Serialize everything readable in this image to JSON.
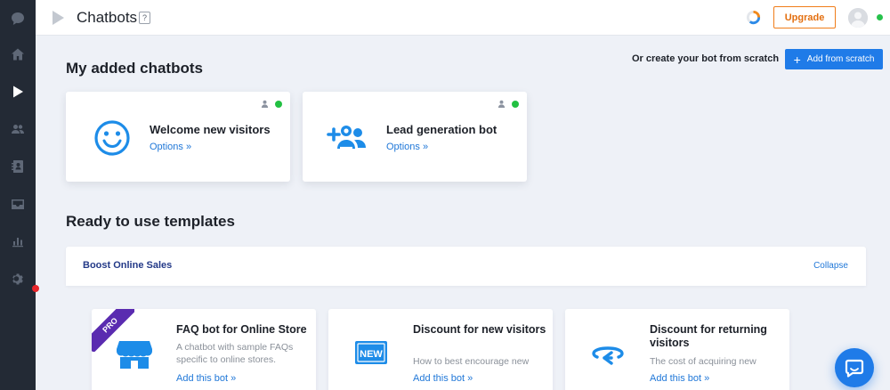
{
  "header": {
    "title": "Chatbots",
    "help_label": "?",
    "upgrade_label": "Upgrade"
  },
  "sidebar": {
    "items": [
      {
        "icon": "chat-icon"
      },
      {
        "icon": "home-icon"
      },
      {
        "icon": "play-icon",
        "active": true
      },
      {
        "icon": "users-icon"
      },
      {
        "icon": "contacts-icon"
      },
      {
        "icon": "inbox-icon"
      },
      {
        "icon": "stats-icon"
      },
      {
        "icon": "gear-icon"
      }
    ]
  },
  "main": {
    "added_title": "My added chatbots",
    "scratch_text": "Or create your bot from scratch",
    "add_button_label": "Add from scratch",
    "bots": [
      {
        "name": "Welcome new visitors",
        "options_label": "Options »",
        "icon": "smiley-icon"
      },
      {
        "name": "Lead generation bot",
        "options_label": "Options »",
        "icon": "add-users-icon"
      }
    ],
    "templates_title": "Ready to use templates",
    "panel": {
      "title": "Boost Online Sales",
      "collapse_label": "Collapse"
    },
    "templates": [
      {
        "title": "FAQ bot for Online Store",
        "desc_line1": "A chatbot with sample FAQs",
        "desc_line2": "specific to online stores.",
        "add_label": "Add this bot »",
        "badge": "PRO",
        "icon": "store-icon"
      },
      {
        "title": "Discount for new visitors",
        "desc_line1": "How to best encourage new",
        "desc_line2": "",
        "add_label": "Add this bot »",
        "badge": "",
        "icon": "new-badge-icon"
      },
      {
        "title": "Discount for returning visitors",
        "desc_line1": "The cost of acquiring new",
        "desc_line2": "",
        "add_label": "Add this bot »",
        "badge": "",
        "icon": "return-arrow-icon"
      }
    ]
  },
  "colors": {
    "sidebar_bg": "#232a35",
    "accent_blue": "#1f7be8",
    "upgrade_orange": "#f07d1a",
    "online_green": "#27c24c",
    "pro_purple": "#5a2bb0"
  }
}
